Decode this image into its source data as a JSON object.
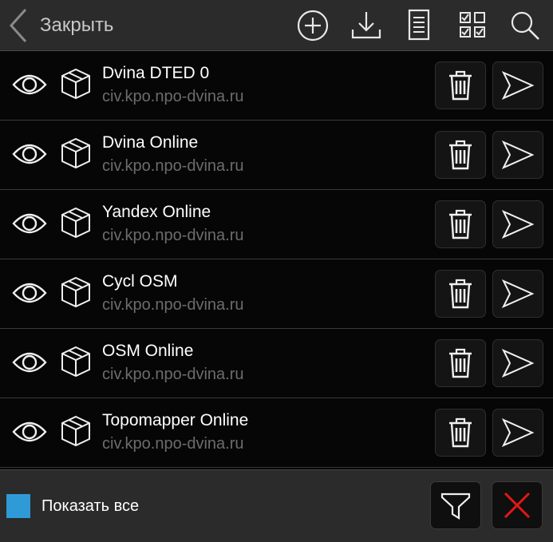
{
  "header": {
    "back_label": "Закрыть",
    "icons": [
      "add-icon",
      "download-icon",
      "document-icon",
      "select-grid-icon",
      "search-icon"
    ]
  },
  "rows": [
    {
      "name": "Dvina DTED 0",
      "url": "civ.kpo.npo-dvina.ru"
    },
    {
      "name": "Dvina Online",
      "url": "civ.kpo.npo-dvina.ru"
    },
    {
      "name": "Yandex Online",
      "url": "civ.kpo.npo-dvina.ru"
    },
    {
      "name": "Cycl OSM",
      "url": "civ.kpo.npo-dvina.ru"
    },
    {
      "name": "OSM Online",
      "url": "civ.kpo.npo-dvina.ru"
    },
    {
      "name": "Topomapper Online",
      "url": "civ.kpo.npo-dvina.ru"
    }
  ],
  "footer": {
    "show_all_label": "Показать все",
    "show_all_checked": true
  },
  "colors": {
    "accent_checkbox": "#2e9bd6",
    "close_red": "#e01818",
    "url_gray": "#6c6c6c"
  }
}
